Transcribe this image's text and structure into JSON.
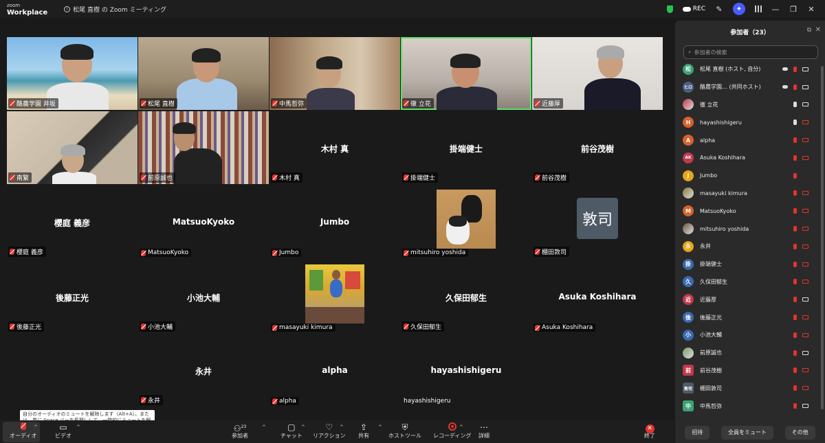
{
  "titlebar": {
    "logo_line1": "zoom",
    "logo_line2": "Workplace",
    "meeting_title": "松尾 直樹 の Zoom ミーティング",
    "rec_label": "REC"
  },
  "tiles": [
    {
      "label": "酪農学園 井坂",
      "center": "",
      "kind": "video"
    },
    {
      "label": "松尾 直樹",
      "center": "",
      "kind": "video"
    },
    {
      "label": "中馬哲弥",
      "center": "",
      "kind": "video"
    },
    {
      "label": "徹 立花",
      "center": "",
      "kind": "video"
    },
    {
      "label": "近藤厚",
      "center": "",
      "kind": "video"
    },
    {
      "label": "南繁",
      "center": "",
      "kind": "video"
    },
    {
      "label": "前原誠也",
      "center": "",
      "kind": "video"
    },
    {
      "label": "木村 真",
      "center": "木村 真",
      "kind": "name"
    },
    {
      "label": "掛端健士",
      "center": "掛端健士",
      "kind": "name"
    },
    {
      "label": "前谷茂樹",
      "center": "前谷茂樹",
      "kind": "name"
    },
    {
      "label": "櫻庭 義彦",
      "center": "櫻庭 義彦",
      "kind": "name"
    },
    {
      "label": "MatsuoKyoko",
      "center": "MatsuoKyoko",
      "kind": "name"
    },
    {
      "label": "Jumbo",
      "center": "Jumbo",
      "kind": "name"
    },
    {
      "label": "mitsuhiro yoshida",
      "center": "",
      "kind": "photo"
    },
    {
      "label": "棚田敦司",
      "center": "",
      "kind": "initial",
      "initial": "敦司"
    },
    {
      "label": "後藤正光",
      "center": "後藤正光",
      "kind": "name"
    },
    {
      "label": "小池大輔",
      "center": "小池大輔",
      "kind": "name"
    },
    {
      "label": "masayuki kimura",
      "center": "",
      "kind": "photo"
    },
    {
      "label": "久保田郁生",
      "center": "久保田郁生",
      "kind": "name"
    },
    {
      "label": "Asuka Koshihara",
      "center": "Asuka Koshihara",
      "kind": "name"
    },
    {
      "label": "永井",
      "center": "永井",
      "kind": "name"
    },
    {
      "label": "alpha",
      "center": "alpha",
      "kind": "name"
    },
    {
      "label": "hayashishigeru",
      "center": "hayashishigeru",
      "kind": "name"
    }
  ],
  "tooltip": "自分のオーディオのミュートを解除します（Alt+A）。または、単に Space バーを長押しして、一時的にミュートを解除します。",
  "toolbar": {
    "audio": "オーディオ",
    "video": "ビデオ",
    "participants": "参加者",
    "participants_count": "23",
    "chat": "チャット",
    "reaction": "リアクション",
    "share": "共有",
    "host_tools": "ホストツール",
    "recording": "レコーディング",
    "more": "詳細",
    "end": "終了"
  },
  "sidebar": {
    "title": "参加者（23）",
    "search_placeholder": "参加者の検索",
    "participants": [
      {
        "name": "松尾 直樹 (ホスト, 自分)",
        "avatar": "松",
        "color": "#3aa374",
        "mic": "muted",
        "cam": "on",
        "cloud": true
      },
      {
        "name": "酪農学園… (共同ホスト)",
        "avatar": "ヒロ",
        "color": "#4a6080",
        "mic": "muted",
        "cam": "on",
        "cloud": true
      },
      {
        "name": "徹 立花",
        "avatar": "",
        "color": "#c0394b",
        "mic": "on",
        "cam": "on",
        "cloud": false
      },
      {
        "name": "hayashishigeru",
        "avatar": "H",
        "color": "#d9622b",
        "mic": "on",
        "cam": "muted",
        "cloud": false
      },
      {
        "name": "alpha",
        "avatar": "A",
        "color": "#d9622b",
        "mic": "muted",
        "cam": "muted",
        "cloud": false
      },
      {
        "name": "Asuka Koshihara",
        "avatar": "AK",
        "color": "#c0394b",
        "mic": "muted",
        "cam": "muted",
        "cloud": false
      },
      {
        "name": "Jumbo",
        "avatar": "J",
        "color": "#e8a317",
        "mic": "muted",
        "cam": "",
        "cloud": false
      },
      {
        "name": "masayuki kimura",
        "avatar": "",
        "color": "#8a7a3a",
        "mic": "muted",
        "cam": "muted",
        "cloud": false
      },
      {
        "name": "MatsuoKyoko",
        "avatar": "M",
        "color": "#d9622b",
        "mic": "muted",
        "cam": "muted",
        "cloud": false
      },
      {
        "name": "mitsuhiro yoshida",
        "avatar": "",
        "color": "#6b5a40",
        "mic": "muted",
        "cam": "muted",
        "cloud": false
      },
      {
        "name": "永井",
        "avatar": "永",
        "color": "#e8a317",
        "mic": "muted",
        "cam": "muted",
        "cloud": false
      },
      {
        "name": "掛端健士",
        "avatar": "掛",
        "color": "#3a6ab0",
        "mic": "muted",
        "cam": "muted",
        "cloud": false
      },
      {
        "name": "久保田郁生",
        "avatar": "久",
        "color": "#3a6ab0",
        "mic": "muted",
        "cam": "muted",
        "cloud": false
      },
      {
        "name": "近藤厚",
        "avatar": "近",
        "color": "#c0394b",
        "mic": "muted",
        "cam": "on",
        "cloud": false
      },
      {
        "name": "後藤正光",
        "avatar": "後",
        "color": "#3a6ab0",
        "mic": "muted",
        "cam": "muted",
        "cloud": false
      },
      {
        "name": "小池大輔",
        "avatar": "小",
        "color": "#3a6ab0",
        "mic": "muted",
        "cam": "muted",
        "cloud": false
      },
      {
        "name": "前原誠也",
        "avatar": "",
        "color": "#7a9a6a",
        "mic": "muted",
        "cam": "on",
        "cloud": false
      },
      {
        "name": "前谷茂樹",
        "avatar": "前",
        "color": "#c0394b",
        "mic": "muted",
        "cam": "muted",
        "cloud": false
      },
      {
        "name": "棚田敦司",
        "avatar": "敦司",
        "color": "#4e5a66",
        "mic": "muted",
        "cam": "muted",
        "cloud": false
      },
      {
        "name": "中馬哲弥",
        "avatar": "中",
        "color": "#3aa374",
        "mic": "muted",
        "cam": "on",
        "cloud": false
      }
    ],
    "invite": "招待",
    "mute_all": "全員をミュート",
    "more": "その他"
  }
}
